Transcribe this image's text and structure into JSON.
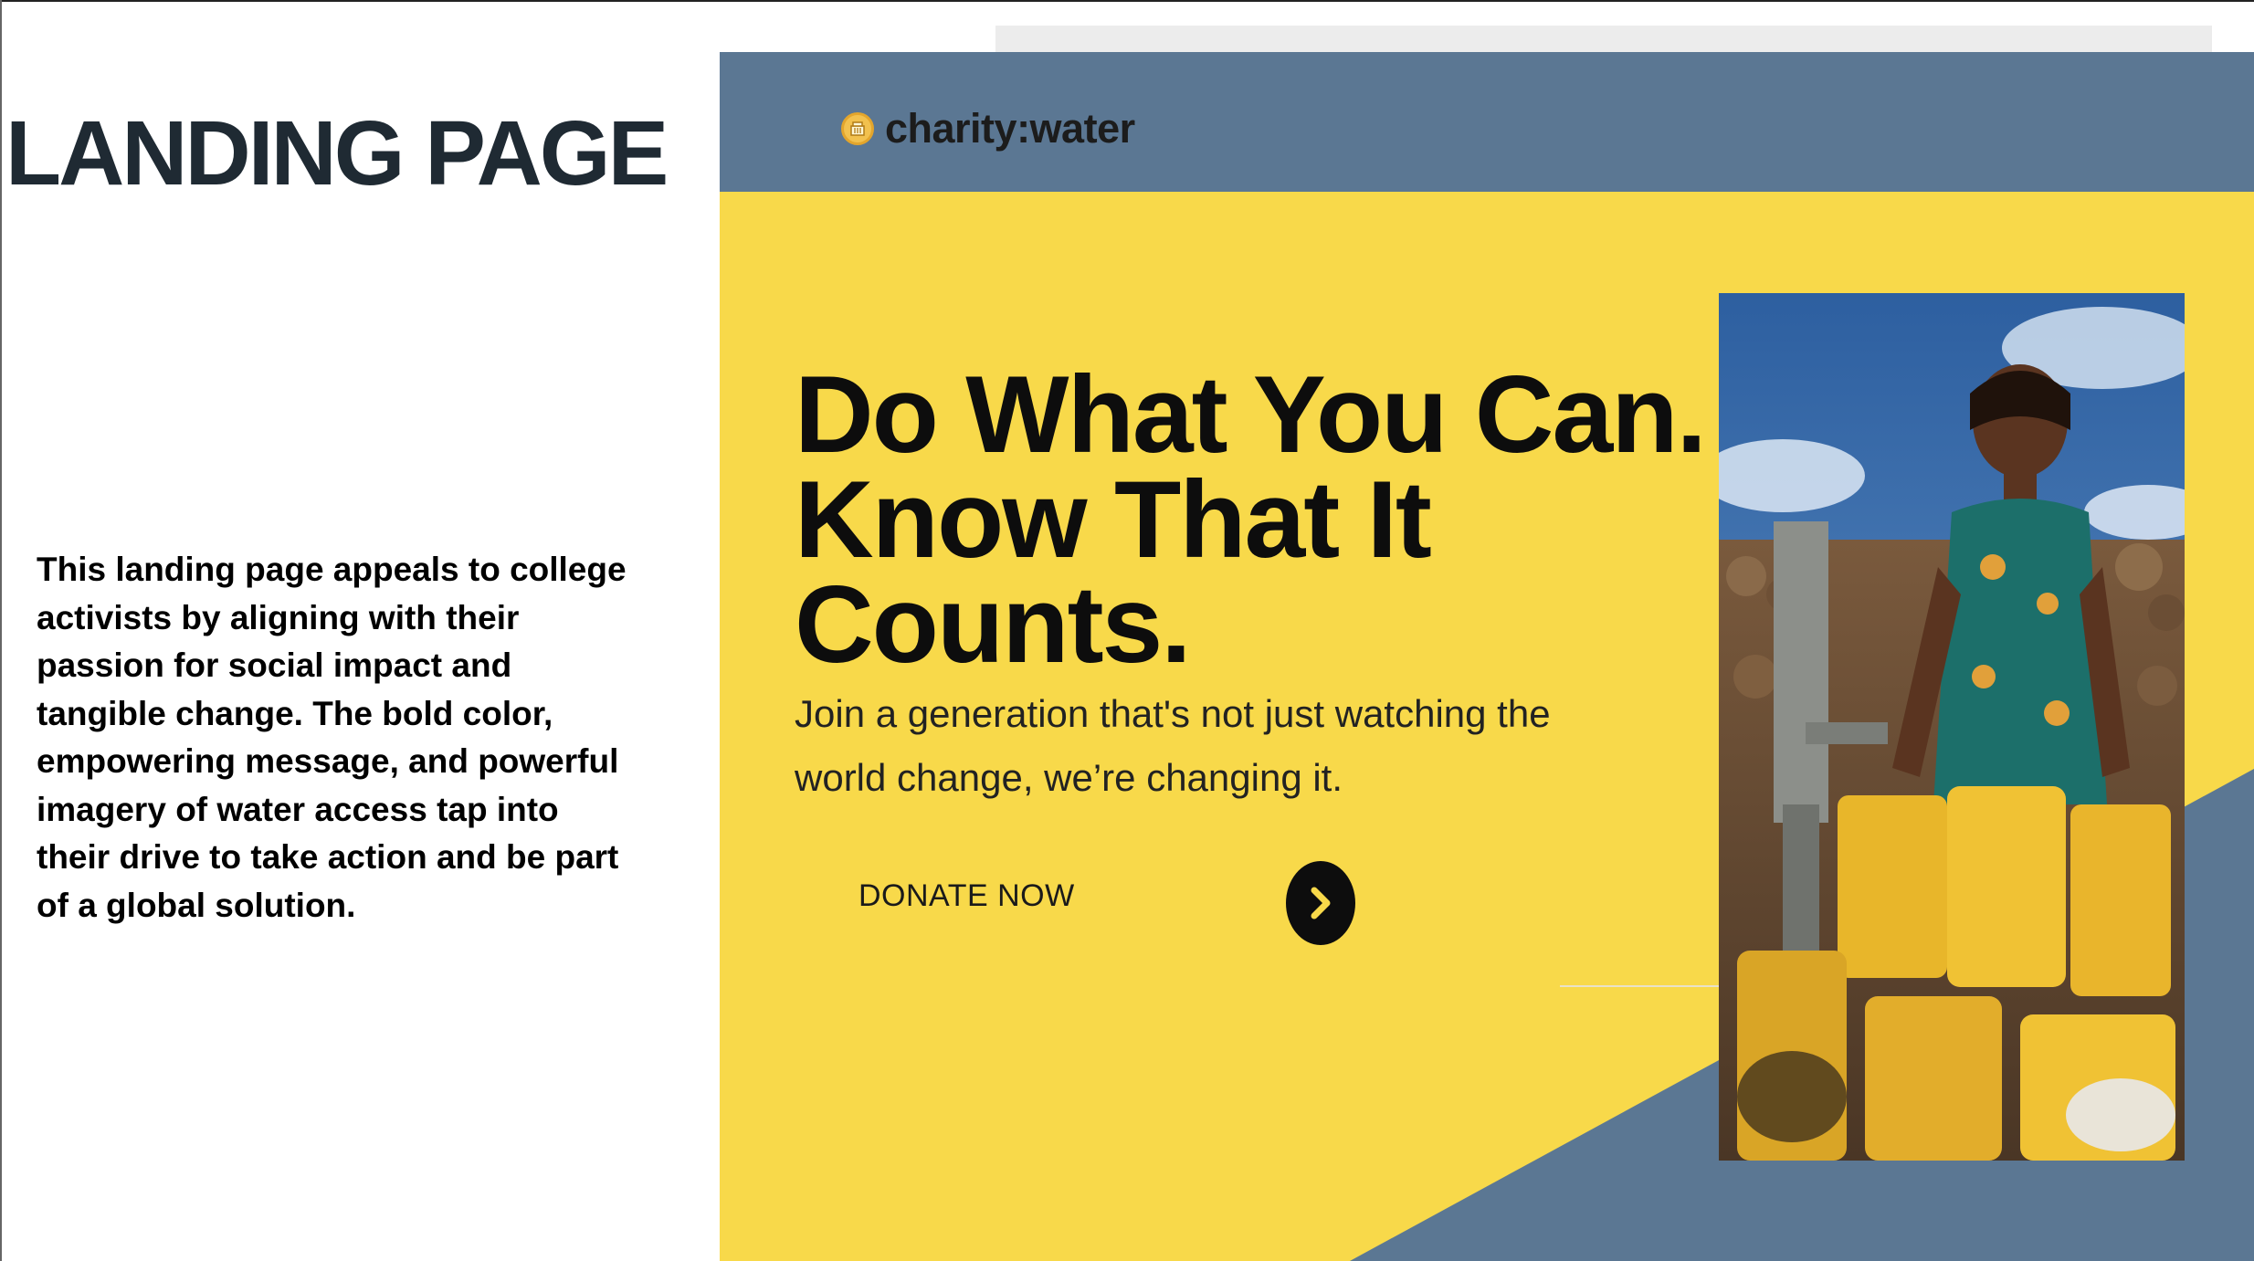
{
  "slide": {
    "title": "LANDING PAGE",
    "description": "This landing page appeals to college activists by aligning with their passion for social impact and tangible change. The bold color, empowering message, and powerful imagery of water access tap into their drive to take action and be part of a global solution."
  },
  "mockup": {
    "logo_text": "charity:water",
    "headline_lines": [
      "Do What You Can.",
      "Know That It",
      "Counts."
    ],
    "subhead_lines": [
      "Join a generation that's not just watching the",
      "world change, we’re changing it."
    ],
    "cta_label": "DONATE NOW",
    "icons": {
      "logo": "charity-water-jerry-can-icon",
      "cta": "chevron-right-icon"
    },
    "colors": {
      "header": "#5b7793",
      "hero": "#f8d94a",
      "text": "#0d0d0d",
      "logo_badge": "#f2c14e"
    }
  }
}
